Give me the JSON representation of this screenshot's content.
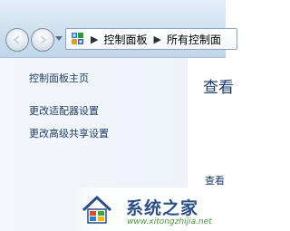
{
  "address_bar": {
    "breadcrumbs": [
      "控制面板",
      "所有控制面"
    ],
    "icon": "control-panel-icon"
  },
  "left_pane": {
    "links": [
      "控制面板主页",
      "更改适配器设置",
      "更改高级共享设置"
    ]
  },
  "content": {
    "heading": "查看",
    "subheading": "查看"
  },
  "watermark": {
    "title": "系统之家",
    "url": "www.xitongzhijia.net"
  }
}
